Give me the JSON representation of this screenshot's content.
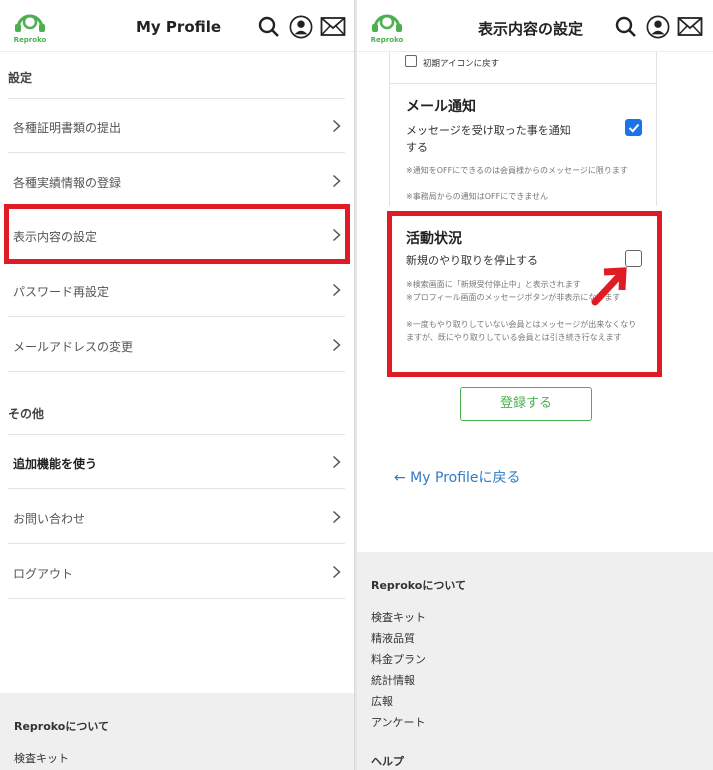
{
  "left": {
    "header": {
      "logo_text": "Reproko",
      "title": "My Profile"
    },
    "sections": [
      {
        "heading": "設定",
        "items": [
          {
            "label": "各種証明書類の提出"
          },
          {
            "label": "各種実績情報の登録"
          },
          {
            "label": "表示内容の設定"
          },
          {
            "label": "パスワード再設定"
          },
          {
            "label": "メールアドレスの変更"
          }
        ]
      },
      {
        "heading": "その他",
        "items": [
          {
            "label": "追加機能を使う"
          },
          {
            "label": "お問い合わせ"
          },
          {
            "label": "ログアウト"
          }
        ]
      }
    ],
    "footer": {
      "heading": "Reprokoについて",
      "links": [
        "検査キット"
      ]
    }
  },
  "right": {
    "header": {
      "logo_text": "Reproko",
      "title": "表示内容の設定"
    },
    "reset_icon": {
      "label": "初期アイコンに戻す",
      "checked": false
    },
    "mail_notice": {
      "title": "メール通知",
      "desc": "メッセージを受け取った事を通知する",
      "checked": true,
      "notes": [
        "※通知をOFFにできるのは会員様からのメッセージに限ります",
        "※事務局からの通知はOFFにできません"
      ]
    },
    "activity": {
      "title": "活動状況",
      "desc": "新規のやり取りを停止する",
      "checked": false,
      "notes": [
        "※検索画面に「新規受付停止中」と表示されます",
        "※プロフィール画面のメッセージボタンが非表示になります",
        "※一度もやり取りしていない会員とはメッセージが出来なくなりますが、既にやり取りしている会員とは引き続き行なえます"
      ]
    },
    "register_button": "登録する",
    "back_link": "← My Profileに戻る",
    "footer": {
      "heading": "Reprokoについて",
      "links": [
        "検査キット",
        "精液品質",
        "料金プラン",
        "統計情報",
        "広報",
        "アンケート"
      ],
      "heading2": "ヘルプ"
    }
  },
  "colors": {
    "accent_green": "#4caf50",
    "highlight_red": "#e01b24",
    "link_blue": "#2f7bc4",
    "check_blue": "#1a73e8"
  },
  "icons": [
    "search-icon",
    "user-icon",
    "mail-icon",
    "chevron-right-icon",
    "arrow-icon",
    "checkbox-icon"
  ]
}
